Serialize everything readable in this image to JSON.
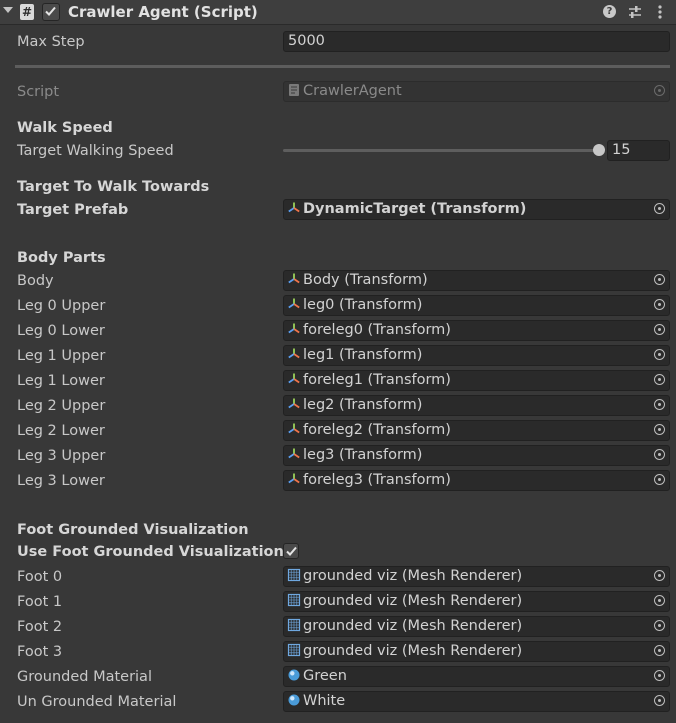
{
  "component": {
    "title": "Crawler Agent (Script)",
    "enabled": true,
    "icon": "script-icon"
  },
  "max_step": {
    "label": "Max Step",
    "value": "5000"
  },
  "script": {
    "label": "Script",
    "value": "CrawlerAgent"
  },
  "walk_speed": {
    "header": "Walk Speed",
    "label": "Target Walking Speed",
    "value": "15",
    "slider_fraction": 1.0
  },
  "target": {
    "header": "Target To Walk Towards",
    "label": "Target Prefab",
    "value": "DynamicTarget (Transform)"
  },
  "body_parts": {
    "header": "Body Parts",
    "rows": [
      {
        "label": "Body",
        "value": "Body (Transform)"
      },
      {
        "label": "Leg 0 Upper",
        "value": "leg0 (Transform)"
      },
      {
        "label": "Leg 0 Lower",
        "value": "foreleg0 (Transform)"
      },
      {
        "label": "Leg 1 Upper",
        "value": "leg1 (Transform)"
      },
      {
        "label": "Leg 1 Lower",
        "value": "foreleg1 (Transform)"
      },
      {
        "label": "Leg 2 Upper",
        "value": "leg2 (Transform)"
      },
      {
        "label": "Leg 2 Lower",
        "value": "foreleg2 (Transform)"
      },
      {
        "label": "Leg 3 Upper",
        "value": "leg3 (Transform)"
      },
      {
        "label": "Leg 3 Lower",
        "value": "foreleg3 (Transform)"
      }
    ]
  },
  "foot_viz": {
    "header": "Foot Grounded Visualization",
    "toggle_label": "Use Foot Grounded Visualization",
    "toggle_checked": true,
    "feet": [
      {
        "label": "Foot 0",
        "value": "grounded viz (Mesh Renderer)"
      },
      {
        "label": "Foot 1",
        "value": "grounded viz (Mesh Renderer)"
      },
      {
        "label": "Foot 2",
        "value": "grounded viz (Mesh Renderer)"
      },
      {
        "label": "Foot 3",
        "value": "grounded viz (Mesh Renderer)"
      }
    ],
    "materials": [
      {
        "label": "Grounded Material",
        "value": "Green"
      },
      {
        "label": "Un Grounded Material",
        "value": "White"
      }
    ]
  },
  "colors": {
    "background": "#383838",
    "field": "#2a2a2a",
    "text": "#d2d2d2"
  }
}
